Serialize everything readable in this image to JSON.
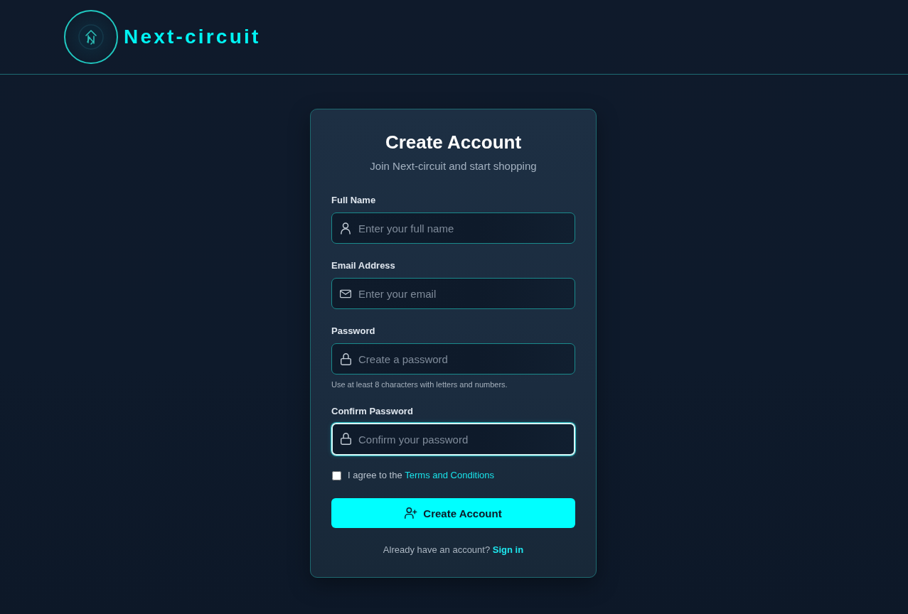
{
  "header": {
    "brand": "Next-circuit"
  },
  "form": {
    "title": "Create Account",
    "subtitle": "Join Next-circuit and start shopping",
    "fields": [
      {
        "label": "Full Name",
        "kind": "text",
        "placeholder": "Enter your full name",
        "focused": false
      },
      {
        "label": "Email Address",
        "kind": "email",
        "placeholder": "Enter your email",
        "focused": false
      },
      {
        "label": "Password",
        "kind": "password",
        "placeholder": "Create a password",
        "hint": "Use at least 8 characters with letters and numbers.",
        "focused": false
      },
      {
        "label": "Confirm Password",
        "kind": "password",
        "placeholder": "Confirm your password",
        "focused": true
      }
    ],
    "terms": {
      "text": "I agree to the",
      "link": "Terms and Conditions",
      "checked": false
    },
    "submit": {
      "label": "Create Account"
    },
    "footer": {
      "text": "Already have an account?",
      "link": "Sign in"
    }
  }
}
